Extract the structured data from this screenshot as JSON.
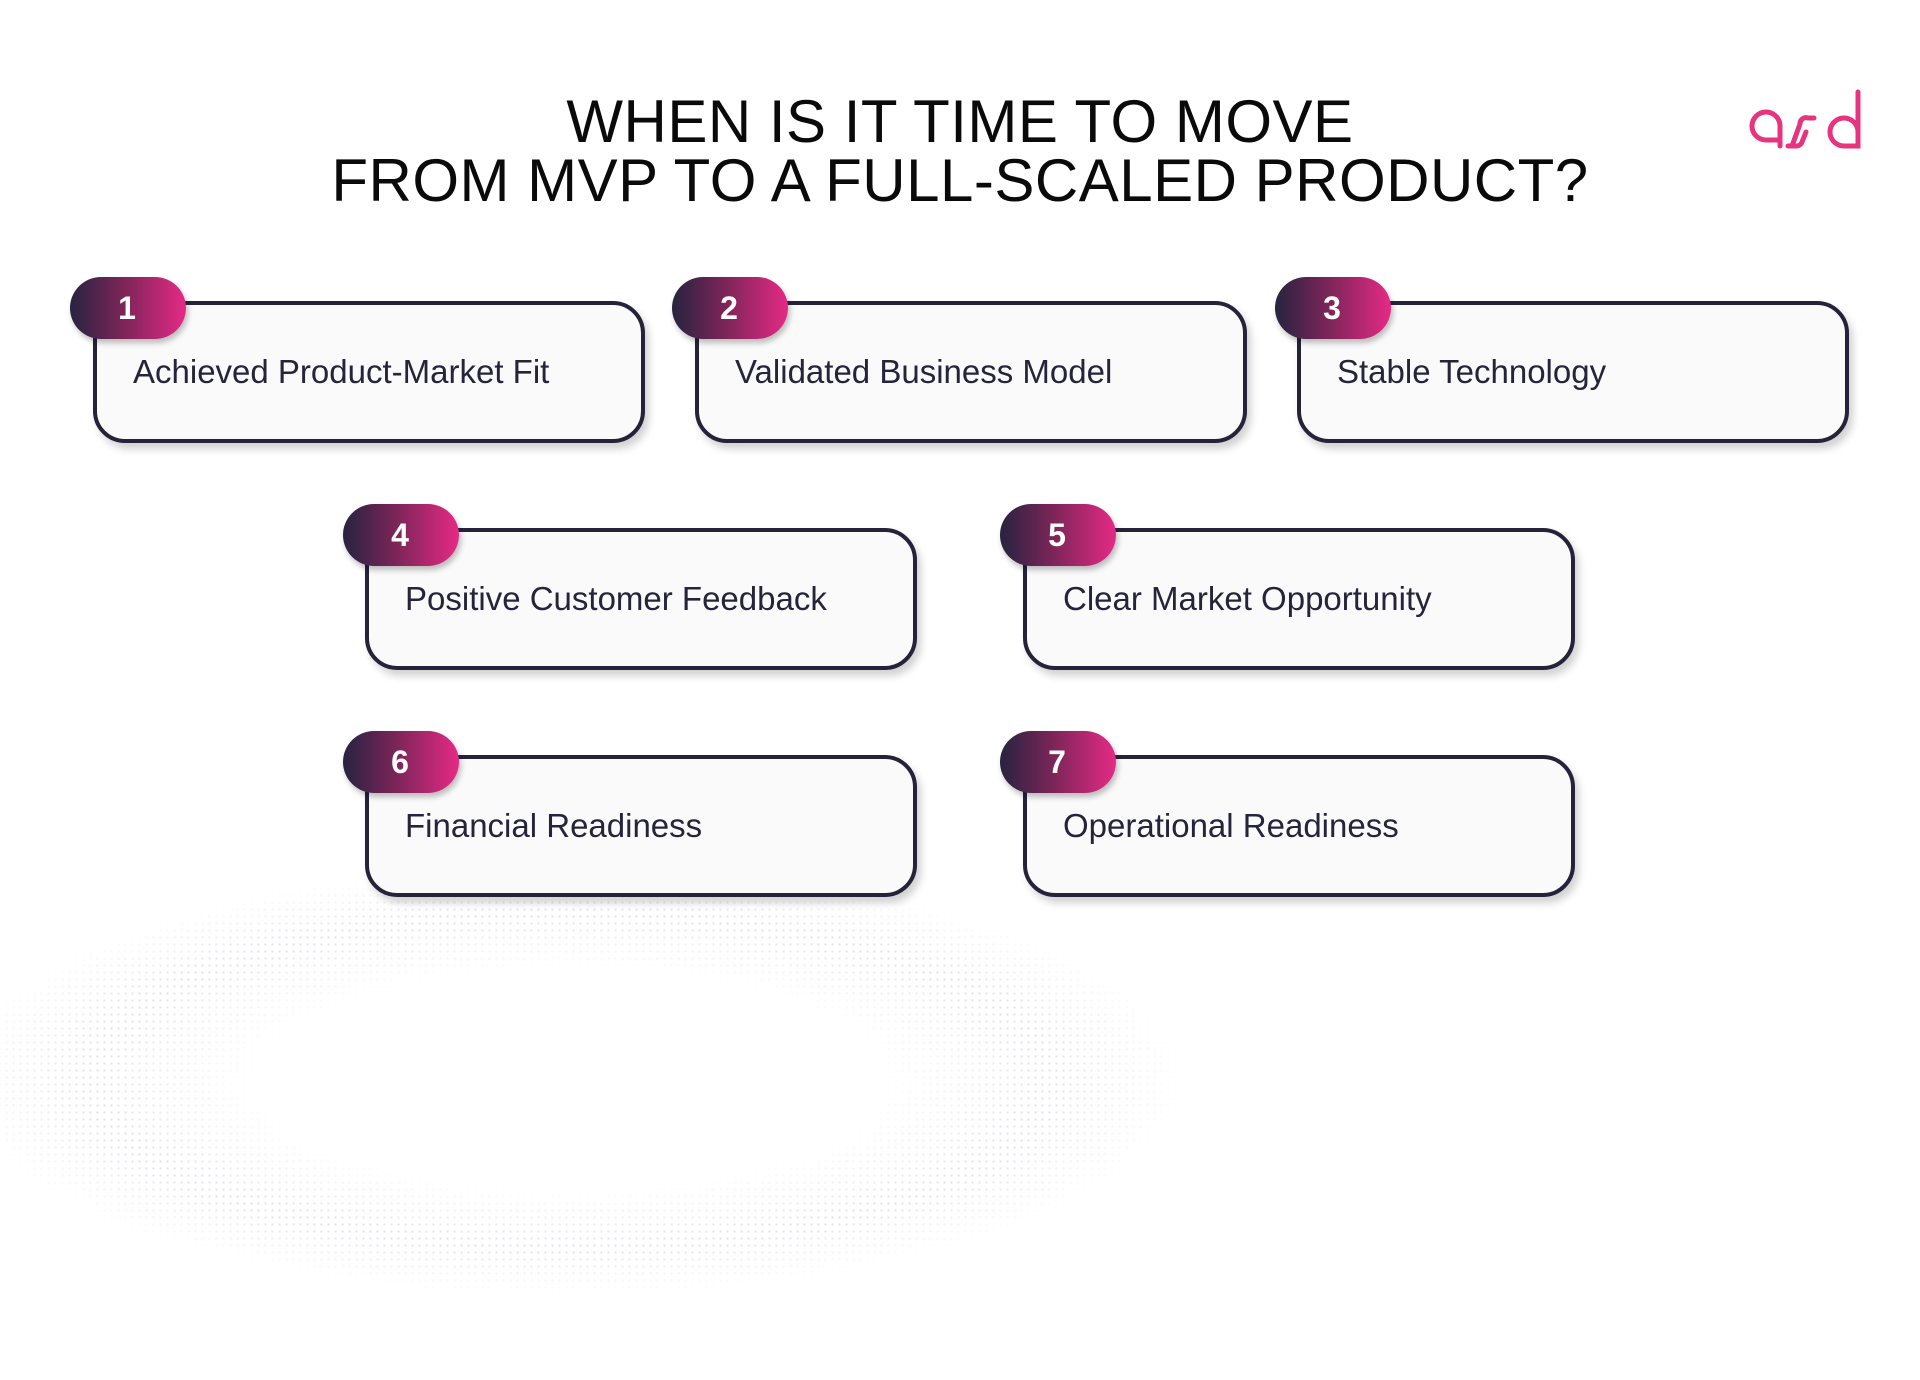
{
  "title": {
    "line1": "WHEN IS IT TIME TO MOVE",
    "line2": "FROM MVP TO A FULL-SCALED PRODUCT?"
  },
  "logo": {
    "text": "asd",
    "color": "#e6347f"
  },
  "colors": {
    "accent": "#e52a85",
    "dark": "#25233a",
    "card_fill": "#fafafa"
  },
  "items": [
    {
      "number": "1",
      "label": "Achieved Product-Market Fit"
    },
    {
      "number": "2",
      "label": "Validated Business Model"
    },
    {
      "number": "3",
      "label": "Stable Technology"
    },
    {
      "number": "4",
      "label": "Positive Customer Feedback"
    },
    {
      "number": "5",
      "label": "Clear Market Opportunity"
    },
    {
      "number": "6",
      "label": "Financial Readiness"
    },
    {
      "number": "7",
      "label": "Operational Readiness"
    }
  ]
}
